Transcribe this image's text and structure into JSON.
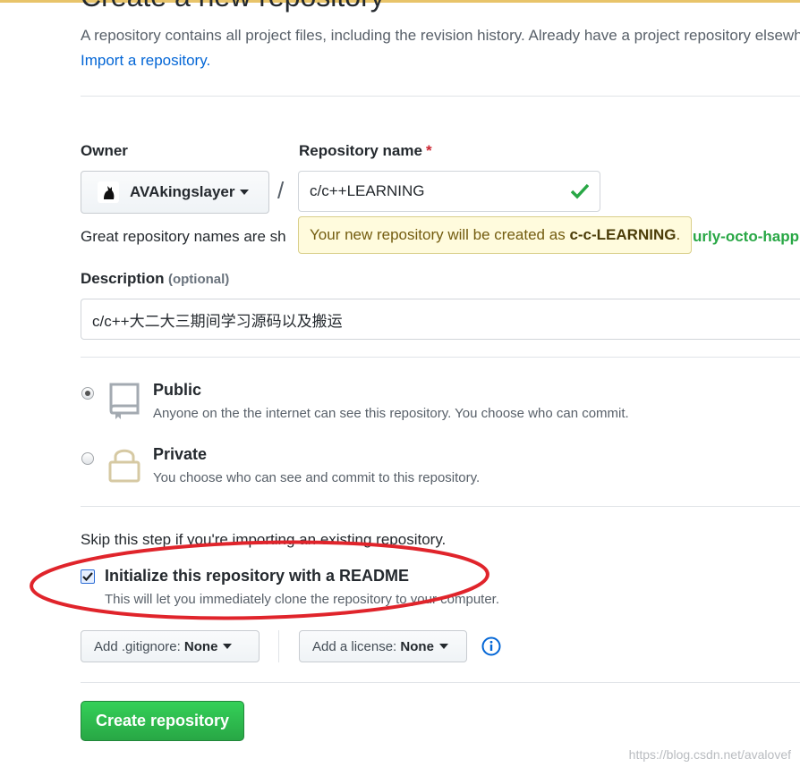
{
  "page": {
    "title": "Create a new repository",
    "subhead": "A repository contains all project files, including the revision history. Already have a project repository elsewhere?",
    "import_link": "Import a repository."
  },
  "owner": {
    "label": "Owner",
    "value": "AVAkingslayer",
    "separator": "/"
  },
  "repo_name": {
    "label": "Repository name",
    "required_mark": "*",
    "value": "c/c++LEARNING",
    "valid_icon": "check-icon"
  },
  "name_hint": {
    "prefix": "Great repository names are sh",
    "suffix": "urly-octo-happ"
  },
  "tooltip": {
    "prefix": "Your new repository will be created as ",
    "repo": "c-c-LEARNING",
    "suffix": "."
  },
  "description": {
    "label": "Description",
    "optional": "(optional)",
    "value": "c/c++大二大三期间学习源码以及搬运"
  },
  "visibility": {
    "selected": "public",
    "options": [
      {
        "id": "public",
        "icon": "repo-icon",
        "title": "Public",
        "desc": "Anyone on the the internet can see this repository. You choose who can commit."
      },
      {
        "id": "private",
        "icon": "lock-icon",
        "title": "Private",
        "desc": "You choose who can see and commit to this repository."
      }
    ]
  },
  "init": {
    "skip_note": "Skip this step if you're importing an existing repository.",
    "readme_checked": true,
    "readme_label": "Initialize this repository with a README",
    "readme_desc": "This will let you immediately clone the repository to your computer."
  },
  "dropdowns": {
    "gitignore_prefix": "Add .gitignore:",
    "gitignore_value": "None",
    "license_prefix": "Add a license:",
    "license_value": "None",
    "info_icon": "info-icon"
  },
  "actions": {
    "create_label": "Create repository"
  },
  "watermark": "https://blog.csdn.net/avalovef",
  "colors": {
    "primary_green": "#28a745",
    "link_blue": "#0366d6",
    "annotation_red": "#e0242b",
    "tooltip_bg": "#fffbdd"
  }
}
